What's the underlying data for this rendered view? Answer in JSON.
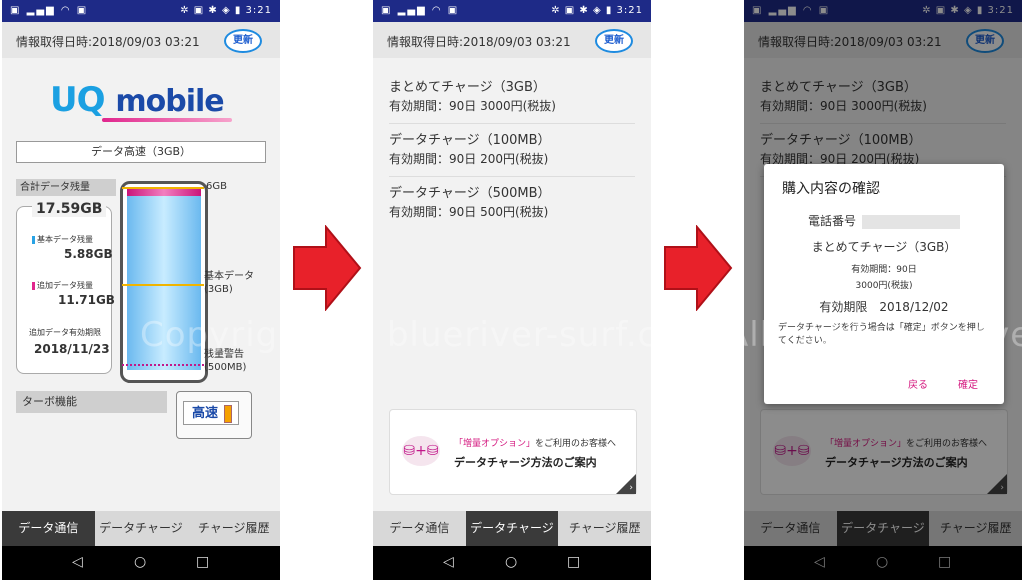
{
  "status": {
    "left_icons": "▣ ▂▄▆ ◠ ▣",
    "right": "✲ ▣ ✱ ◈ ▮ 3:21"
  },
  "info": {
    "label": "情報取得日時:2018/09/03 03:21",
    "refresh": "更新"
  },
  "screen1": {
    "logo_uq": "UQ",
    "logo_mobile": "mobile",
    "plan": "データ高速（3GB）",
    "total_label": "合計データ残量",
    "total_value": "17.59GB",
    "basic_label": "基本データ残量",
    "basic_value": "5.88GB",
    "extra_label": "追加データ残量",
    "extra_value": "11.71GB",
    "expiry_label": "追加データ有効期限",
    "expiry_value": "2018/11/23",
    "level_6gb": "6GB",
    "level_basic_1": "基本データ",
    "level_basic_2": "(3GB)",
    "level_warn_1": "残量警告",
    "level_warn_2": "(500MB)",
    "turbo_label": "ターボ機能",
    "turbo_state": "高速"
  },
  "tabs": [
    "データ通信",
    "データチャージ",
    "チャージ履歴"
  ],
  "nav": {
    "back": "◁",
    "home": "○",
    "recent": "□"
  },
  "charges": [
    {
      "name": "まとめてチャージ（3GB）",
      "detail": "有効期間：90日 3000円(税抜)"
    },
    {
      "name": "データチャージ（100MB）",
      "detail": "有効期間：90日 200円(税抜)"
    },
    {
      "name": "データチャージ（500MB）",
      "detail": "有効期間：90日 500円(税抜)"
    }
  ],
  "banner": {
    "line1_pink": "「増量オプション」",
    "line1_rest": "をご利用のお客様へ",
    "line2": "データチャージ方法のご案内",
    "icon": "⛁+⛁",
    "corner": "›"
  },
  "dialog": {
    "title": "購入内容の確認",
    "phone_label": "電話番号",
    "item": "まとめてチャージ（3GB）",
    "period": "有効期間：90日",
    "price": "3000円(税抜)",
    "expiry": "有効期限　2018/12/02",
    "note": "データチャージを行う場合は「確定」ボタンを押してください。",
    "back": "戻る",
    "confirm": "確定"
  },
  "watermark": "Copyright (c) blueriver-surf.com All rights reserved",
  "colors": {
    "status_bar": "#1e2a87",
    "accent_pink": "#d4187f",
    "arrow": "#e8212a",
    "tab_active": "#3a3a3a"
  },
  "tank_levels": {
    "capacity_gb": 6,
    "pink_top_gb": 6,
    "basic_line_gb": 3,
    "warning_line_gb": 0.5,
    "remaining_fraction": 0.95
  }
}
